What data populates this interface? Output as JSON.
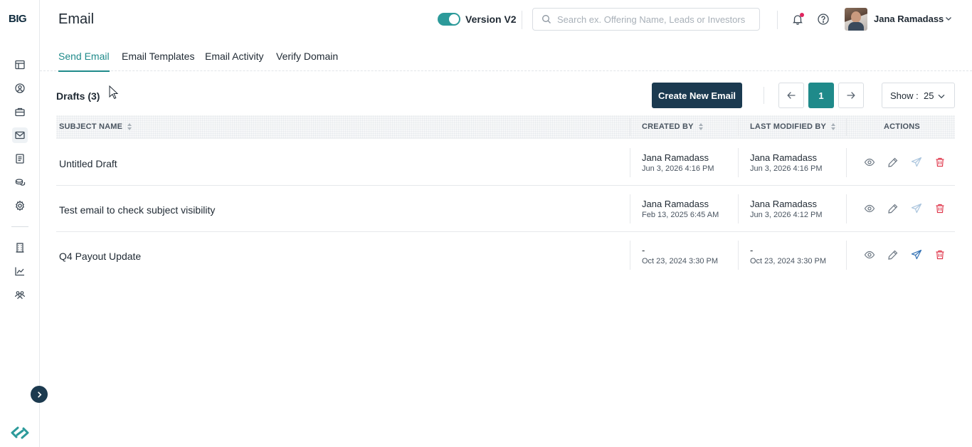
{
  "brand": {
    "logo_text_b": "B",
    "logo_text_ig": "IG"
  },
  "header": {
    "title": "Email",
    "version_label": "Version V2",
    "search_placeholder": "Search ex. Offering Name, Leads or Investors",
    "user_name": "Jana Ramadass"
  },
  "tabs": [
    {
      "label": "Send Email",
      "active": true
    },
    {
      "label": "Email Templates",
      "active": false
    },
    {
      "label": "Email Activity",
      "active": false
    },
    {
      "label": "Verify Domain",
      "active": false
    }
  ],
  "toolbar": {
    "drafts_label": "Drafts (3)",
    "create_label": "Create New Email",
    "current_page": "1",
    "show_label": "Show :  25"
  },
  "table": {
    "headers": {
      "subject": "SUBJECT NAME",
      "created": "CREATED BY",
      "modified": "LAST MODIFIED BY",
      "actions": "ACTIONS"
    },
    "rows": [
      {
        "subject": "Untitled Draft",
        "created_by": "Jana Ramadass",
        "created_at": "Jun 3, 2026 4:16 PM",
        "modified_by": "Jana Ramadass",
        "modified_at": "Jun 3, 2026 4:16 PM",
        "send_enabled": false
      },
      {
        "subject": "Test email to check subject visibility",
        "created_by": "Jana Ramadass",
        "created_at": "Feb 13, 2025 6:45 AM",
        "modified_by": "Jana Ramadass",
        "modified_at": "Jun 3, 2026 4:12 PM",
        "send_enabled": false
      },
      {
        "subject": "Q4 Payout Update",
        "created_by": "-",
        "created_at": "Oct 23, 2024 3:30 PM",
        "modified_by": "-",
        "modified_at": "Oct 23, 2024 3:30 PM",
        "send_enabled": true
      }
    ]
  },
  "colors": {
    "accent": "#1f8a8a",
    "primary_button": "#1b3a50",
    "delete": "#e0394d",
    "send_enabled": "#2f6fb3",
    "send_disabled": "#a9c4dd"
  },
  "icons": {
    "sidebar": [
      "dashboard-icon",
      "user-circle-icon",
      "briefcase-icon",
      "mail-icon",
      "document-icon",
      "coins-icon",
      "settings-icon",
      "building-icon",
      "chart-line-icon",
      "users-group-icon"
    ],
    "header": [
      "search-icon",
      "bell-icon",
      "help-icon",
      "chevron-down-icon"
    ],
    "row_actions": [
      "eye-icon",
      "pencil-icon",
      "send-icon",
      "trash-icon"
    ]
  }
}
